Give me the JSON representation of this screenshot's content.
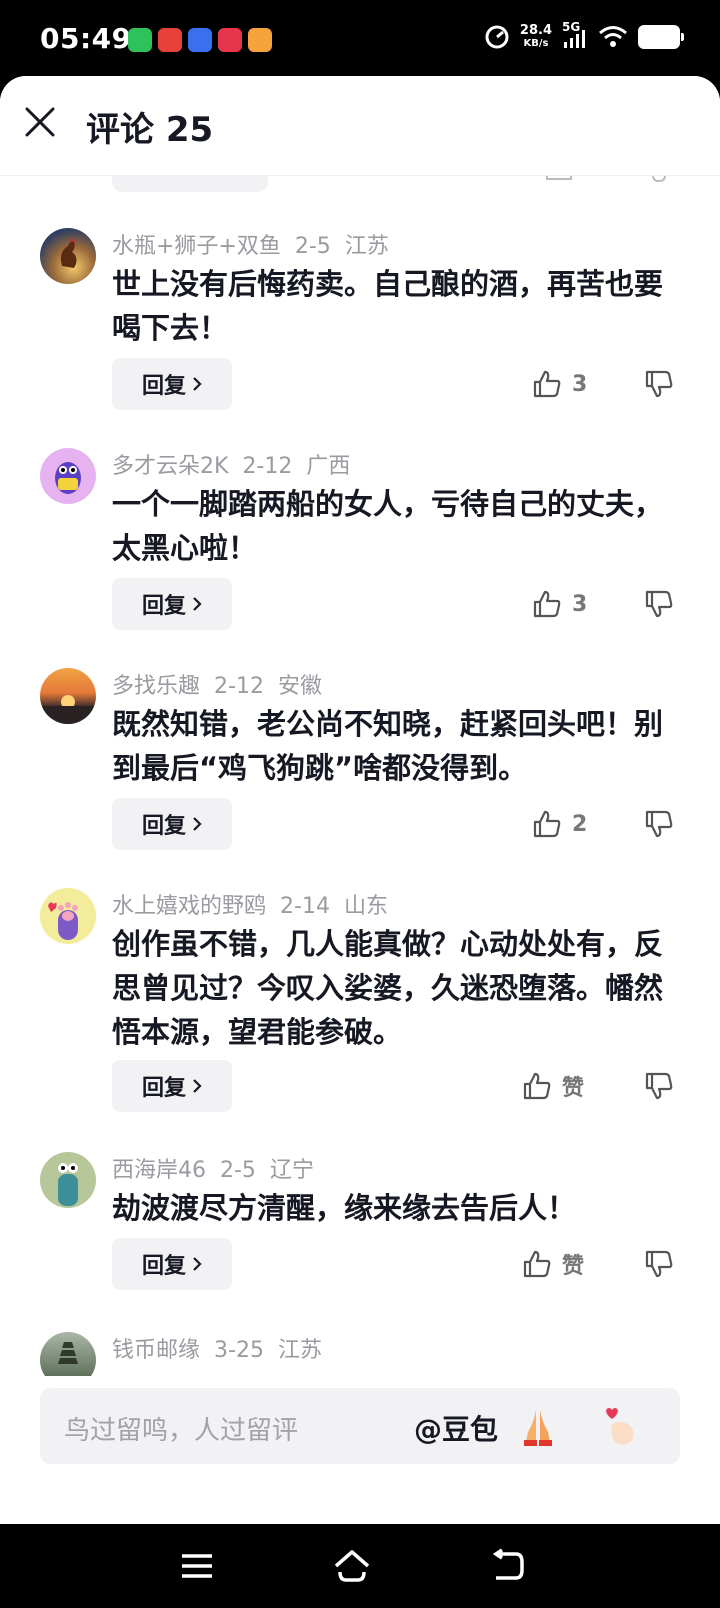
{
  "status_bar": {
    "time": "05:49",
    "speed_value": "28.4",
    "speed_unit": "KB/s",
    "network": "5G"
  },
  "header": {
    "title": "评论 25"
  },
  "comments": [
    {
      "user": "水瓶+狮子+双鱼",
      "date": "2-5",
      "location": "江苏",
      "text": "世上没有后悔药卖。自己酿的酒，再苦也要喝下去！",
      "reply_label": "回复",
      "likes": "3"
    },
    {
      "user": "多才云朵2K",
      "date": "2-12",
      "location": "广西",
      "text": "一个一脚踏两船的女人，亏待自己的丈夫，太黑心啦！",
      "reply_label": "回复",
      "likes": "3"
    },
    {
      "user": "多找乐趣",
      "date": "2-12",
      "location": "安徽",
      "text": "既然知错，老公尚不知晓，赶紧回头吧！别到最后“鸡飞狗跳”啥都没得到。",
      "reply_label": "回复",
      "likes": "2"
    },
    {
      "user": "水上嬉戏的野鸥",
      "date": "2-14",
      "location": "山东",
      "text": "创作虽不错，几人能真做？心动处处有，反思曾见过？今叹入娑婆，久迷恐堕落。幡然悟本源，望君能参破。",
      "reply_label": "回复",
      "likes": "赞"
    },
    {
      "user": "西海岸46",
      "date": "2-5",
      "location": "辽宁",
      "text": "劫波渡尽方清醒，缘来缘去告后人！",
      "reply_label": "回复",
      "likes": "赞"
    },
    {
      "user": "钱币邮缘",
      "date": "3-25",
      "location": "江苏"
    }
  ],
  "input": {
    "placeholder": "鸟过留鸣，人过留评",
    "mention": "@豆包"
  },
  "icons": {
    "close": "close-icon",
    "like": "thumbs-up-icon",
    "dislike": "thumbs-down-icon",
    "pray": "praying-hands-icon",
    "finger_heart": "finger-heart-icon"
  }
}
